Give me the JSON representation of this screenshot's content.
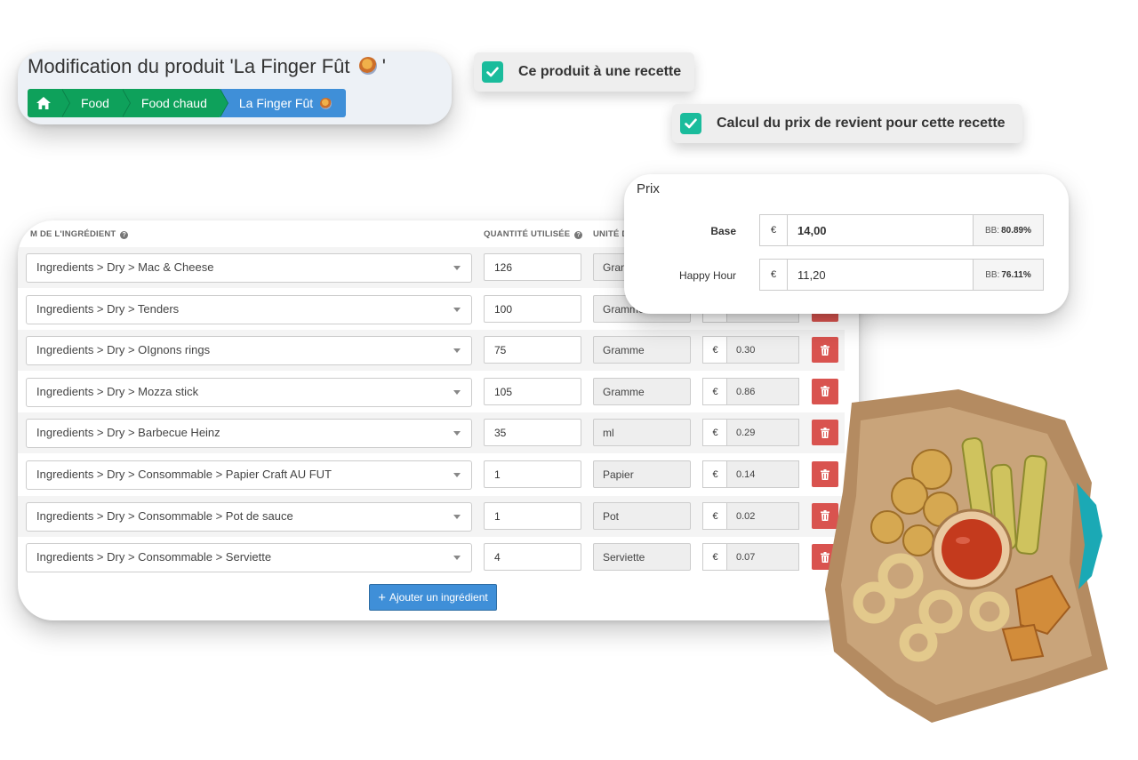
{
  "header": {
    "title": "Modification du produit 'La Finger Fût ",
    "title_end": "'",
    "breadcrumb": {
      "home_icon": "home-icon",
      "items": [
        "Food",
        "Food chaud"
      ],
      "active": "La Finger Fût"
    }
  },
  "options": {
    "has_recipe_label": "Ce produit à une recette",
    "cost_calc_label": "Calcul du prix de revient pour cette recette"
  },
  "table": {
    "headers": {
      "name": "M DE L'INGRÉDIENT",
      "quantity": "QUANTITÉ UTILISÉE",
      "unit": "UNITÉ D"
    },
    "rows": [
      {
        "ingredient": "Ingredients > Dry > Mac & Cheese",
        "qty": "126",
        "unit": "Gramme",
        "currency": "€",
        "cost": ""
      },
      {
        "ingredient": "Ingredients > Dry > Tenders",
        "qty": "100",
        "unit": "Gramme",
        "currency": "€",
        "cost": ""
      },
      {
        "ingredient": "Ingredients > Dry > OIgnons rings",
        "qty": "75",
        "unit": "Gramme",
        "currency": "€",
        "cost": "0.30"
      },
      {
        "ingredient": "Ingredients > Dry > Mozza stick",
        "qty": "105",
        "unit": "Gramme",
        "currency": "€",
        "cost": "0.86"
      },
      {
        "ingredient": "Ingredients > Dry > Barbecue Heinz",
        "qty": "35",
        "unit": "ml",
        "currency": "€",
        "cost": "0.29"
      },
      {
        "ingredient": "Ingredients > Dry > Consommable > Papier Craft AU FUT",
        "qty": "1",
        "unit": "Papier",
        "currency": "€",
        "cost": "0.14"
      },
      {
        "ingredient": "Ingredients > Dry > Consommable > Pot de sauce",
        "qty": "1",
        "unit": "Pot",
        "currency": "€",
        "cost": "0.02"
      },
      {
        "ingredient": "Ingredients > Dry > Consommable > Serviette",
        "qty": "4",
        "unit": "Serviette",
        "currency": "€",
        "cost": "0.07"
      }
    ],
    "add_button": "Ajouter un ingrédient"
  },
  "price": {
    "title": "Prix",
    "rows": [
      {
        "label": "Base",
        "currency": "€",
        "value": "14,00",
        "bb_label": "BB:",
        "bb_value": "80.89%"
      },
      {
        "label": "Happy Hour",
        "currency": "€",
        "value": "11,20",
        "bb_label": "BB:",
        "bb_value": "76.11%"
      }
    ]
  },
  "colors": {
    "breadcrumb_green": "#0ea15b",
    "accent_blue": "#3f8fd8",
    "checkbox_teal": "#1abc9c",
    "delete_red": "#d9534f"
  }
}
